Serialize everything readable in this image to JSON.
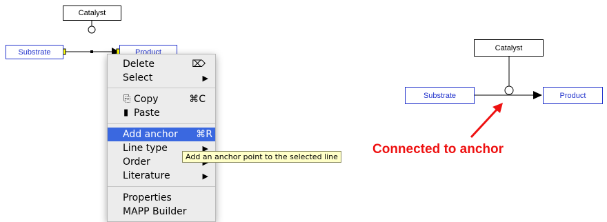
{
  "left_diagram": {
    "catalyst": "Catalyst",
    "substrate": "Substrate",
    "product": "Product"
  },
  "context_menu": {
    "delete": {
      "label": "Delete",
      "shortcut": "⌦"
    },
    "select": {
      "label": "Select"
    },
    "copy": {
      "label": "Copy",
      "shortcut": "⌘C"
    },
    "paste": {
      "label": "Paste"
    },
    "add_anchor": {
      "label": "Add anchor",
      "shortcut": "⌘R"
    },
    "line_type": {
      "label": "Line type"
    },
    "order": {
      "label": "Order"
    },
    "literature": {
      "label": "Literature"
    },
    "properties": {
      "label": "Properties"
    },
    "mapp_builder": {
      "label": "MAPP Builder"
    }
  },
  "tooltip": "Add an anchor point to the selected line",
  "right_diagram": {
    "catalyst": "Catalyst",
    "substrate": "Substrate",
    "product": "Product"
  },
  "annotation": "Connected to anchor",
  "colors": {
    "node_blue": "#2233cc",
    "annotation_red": "#ee1111",
    "menu_highlight": "#3a68e0",
    "handle_yellow": "#ffff00"
  }
}
